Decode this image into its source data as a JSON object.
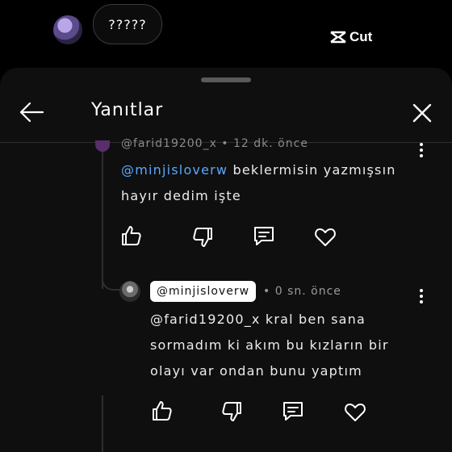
{
  "top": {
    "bubble_text": "?????",
    "watermark": "Cut"
  },
  "sheet": {
    "title": "Yanıtlar"
  },
  "comment1": {
    "meta": "@farid19200_x • 12 dk. önce",
    "mention": "@minjisloverw",
    "line1_rest": " beklermisin yazmışsın",
    "line2": "hayır dedim işte"
  },
  "comment2": {
    "username": "@minjisloverw",
    "meta": "• 0 sn. önce",
    "line1": "@farid19200_x kral ben sana",
    "line2": "sormadım ki akım bu kızların bir",
    "line3": "olayı var ondan bunu yaptım"
  }
}
